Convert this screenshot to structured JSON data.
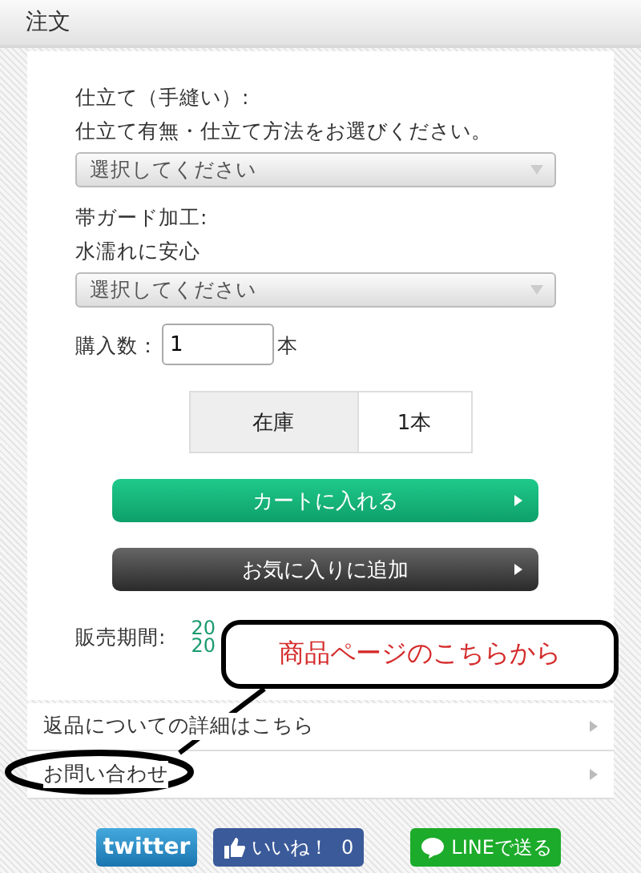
{
  "header": {
    "title": "注文"
  },
  "options": [
    {
      "label": "仕立て（手縫い）:",
      "description": "仕立て有無・仕立て方法をお選びください。",
      "value": "選択してください"
    },
    {
      "label": "帯ガード加工:",
      "description": "水濡れに安心",
      "value": "選択してください"
    }
  ],
  "quantity": {
    "label": "購入数：",
    "value": "1",
    "unit": "本"
  },
  "stock": {
    "label": "在庫",
    "value": "1本"
  },
  "actions": [
    {
      "kind": "cart",
      "label": "カートに入れる"
    },
    {
      "kind": "favorite",
      "label": "お気に入りに追加"
    }
  ],
  "sales_period": {
    "label": "販売期間:",
    "lines": [
      "20",
      "20"
    ]
  },
  "links": [
    {
      "label": "返品についての詳細はこちら"
    },
    {
      "label": "お問い合わせ"
    }
  ],
  "social": [
    {
      "kind": "twitter",
      "label": "twitter"
    },
    {
      "kind": "like",
      "label": "いいね！",
      "count": "0"
    },
    {
      "kind": "line",
      "label": "LINEで送る"
    }
  ],
  "annotation": {
    "text": "商品ページのこちらから"
  }
}
